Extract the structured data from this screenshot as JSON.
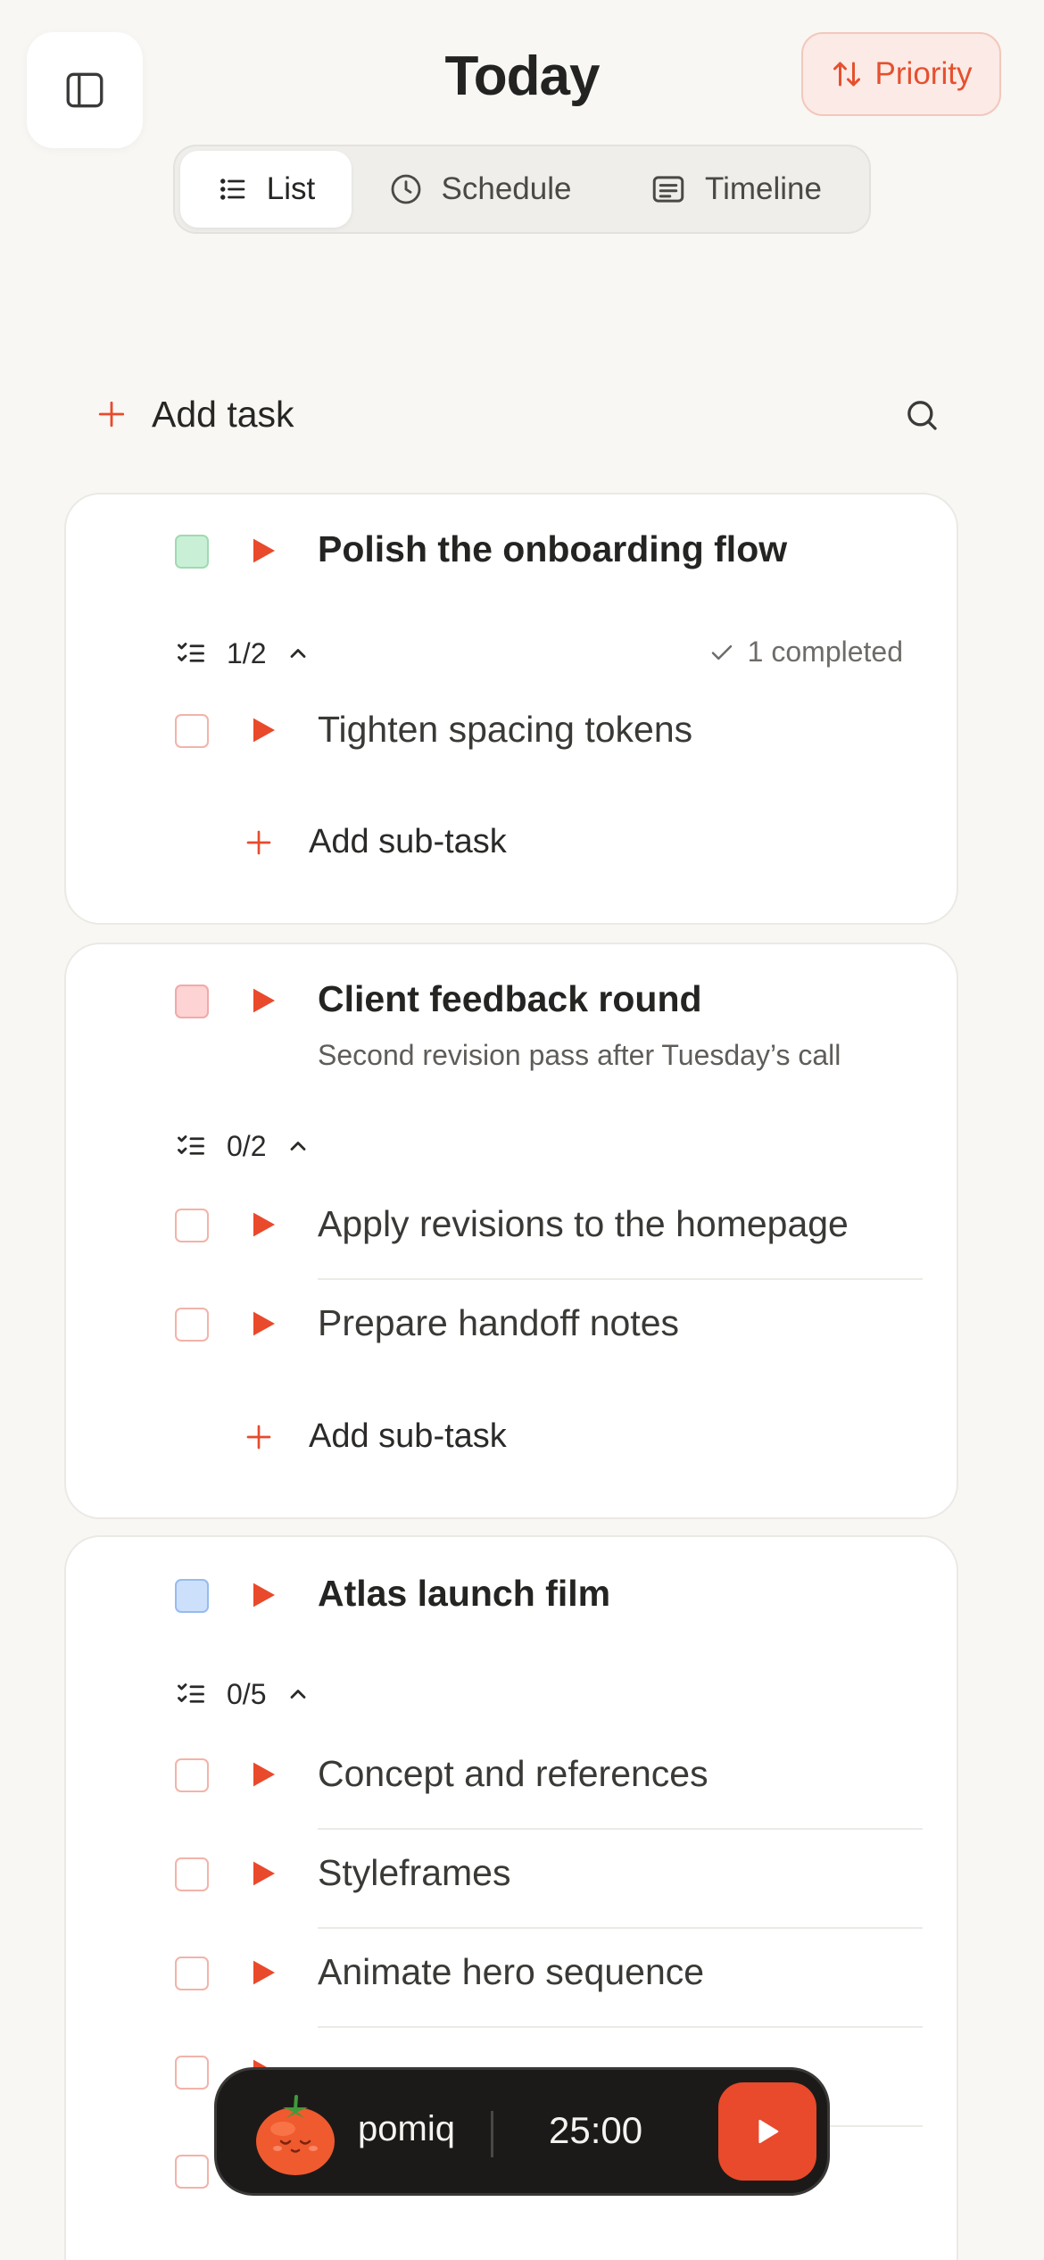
{
  "header": {
    "title": "Today",
    "priority_label": "Priority"
  },
  "view_switch": {
    "tabs": [
      {
        "label": "List",
        "icon": "list-icon",
        "active": true
      },
      {
        "label": "Schedule",
        "icon": "clock-icon",
        "active": false
      },
      {
        "label": "Timeline",
        "icon": "timeline-icon",
        "active": false
      }
    ]
  },
  "add_task": {
    "label": "Add task"
  },
  "cards": [
    {
      "title": "Polish the onboarding flow",
      "color": "green",
      "progress": "1/2",
      "completed_label": "1 completed",
      "subtasks": [
        "Tighten spacing tokens"
      ],
      "add_sub_label": "Add sub-task"
    },
    {
      "title": "Client feedback round",
      "note": "Second revision pass after Tuesday’s call",
      "color": "pink",
      "progress": "0/2",
      "subtasks": [
        "Apply revisions to the homepage",
        "Prepare handoff notes"
      ],
      "add_sub_label": "Add sub-task"
    },
    {
      "title": "Atlas launch film",
      "color": "blue",
      "progress": "0/5",
      "subtasks": [
        "Concept and references",
        "Styleframes",
        "Animate hero sequence"
      ]
    }
  ],
  "timer": {
    "name": "pomiq",
    "time": "25:00"
  },
  "colors": {
    "accent": "#E84A2B",
    "background": "#F8F7F4",
    "card": "#FFFFFF",
    "timer_bg": "#1C1A19"
  }
}
